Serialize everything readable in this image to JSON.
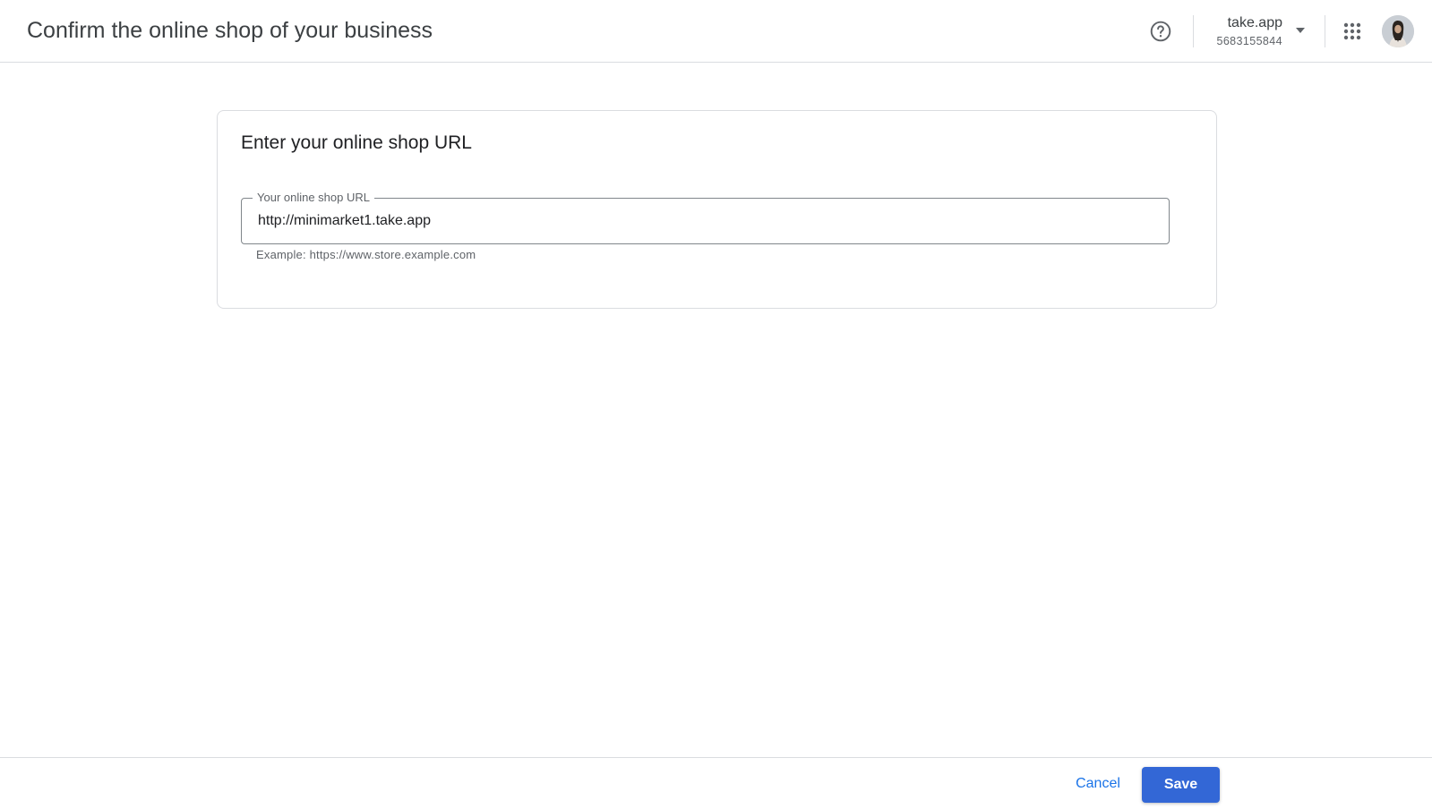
{
  "header": {
    "title": "Confirm the online shop of your business",
    "help_icon": "help-circle-icon",
    "account": {
      "name": "take.app",
      "id": "5683155844",
      "dropdown_icon": "arrow-drop-down-icon"
    },
    "apps_icon": "apps-grid-icon",
    "avatar_icon": "user-avatar"
  },
  "card": {
    "title": "Enter your online shop URL",
    "url_field": {
      "label": "Your online shop URL",
      "value": "http://minimarket1.take.app",
      "helper": "Example: https://www.store.example.com"
    }
  },
  "footer": {
    "cancel_label": "Cancel",
    "save_label": "Save"
  },
  "colors": {
    "primary": "#3367d6",
    "link": "#1a73e8",
    "border": "#dadce0",
    "text": "#202124",
    "secondary_text": "#5f6368"
  }
}
